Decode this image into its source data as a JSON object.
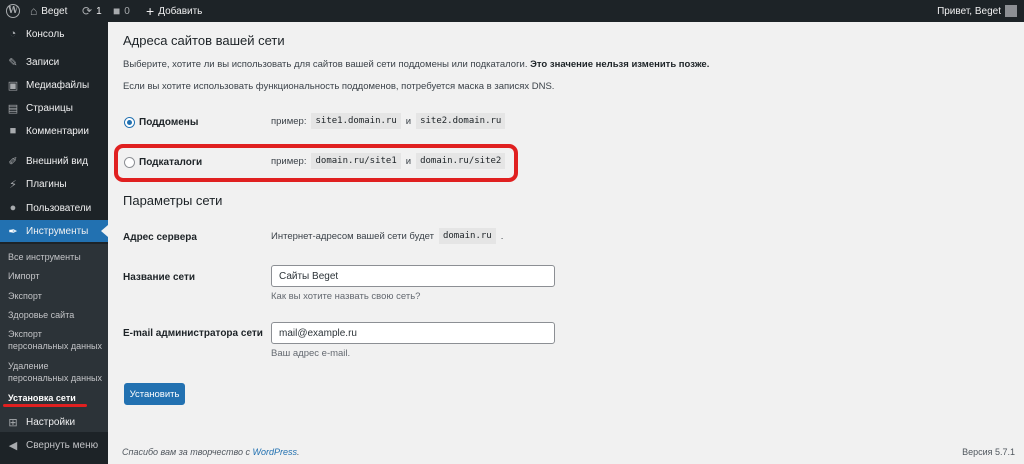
{
  "adminbar": {
    "site_name": "Beget",
    "updates_count": "1",
    "comments_count": "0",
    "add_new_label": "Добавить",
    "greeting": "Привет, Beget"
  },
  "sidebar": {
    "items": [
      {
        "label": "Консоль",
        "icon": "dashboard-icon"
      },
      {
        "label": "Записи",
        "icon": "pin-icon"
      },
      {
        "label": "Медиафайлы",
        "icon": "media-icon"
      },
      {
        "label": "Страницы",
        "icon": "pages-icon"
      },
      {
        "label": "Комментарии",
        "icon": "comment-icon"
      },
      {
        "label": "Внешний вид",
        "icon": "brush-icon"
      },
      {
        "label": "Плагины",
        "icon": "plug-icon"
      },
      {
        "label": "Пользователи",
        "icon": "users-icon"
      },
      {
        "label": "Инструменты",
        "icon": "wrench-icon"
      },
      {
        "label": "Настройки",
        "icon": "settings-icon"
      },
      {
        "label": "Свернуть меню",
        "icon": "collapse-icon"
      }
    ],
    "submenu": [
      "Все инструменты",
      "Импорт",
      "Экспорт",
      "Здоровье сайта",
      "Экспорт",
      "персональных данных",
      "Удаление",
      "персональных данных",
      "Установка сети"
    ]
  },
  "main": {
    "addresses_title": "Адреса сайтов вашей сети",
    "intro_text": "Выберите, хотите ли вы использовать для сайтов вашей сети поддомены или подкаталоги.",
    "intro_bold": "Это значение нельзя изменить позже.",
    "dns_note": "Если вы хотите использовать функциональность поддоменов, потребуется маска в записях DNS.",
    "subdomains_label": "Поддомены",
    "subdirs_label": "Подкаталоги",
    "example_prefix": "пример:",
    "and_word": "и",
    "subdomain_ex1": "site1.domain.ru",
    "subdomain_ex2": "site2.domain.ru",
    "subdir_ex1": "domain.ru/site1",
    "subdir_ex2": "domain.ru/site2",
    "params_title": "Параметры сети",
    "server_address_label": "Адрес сервера",
    "server_address_text": "Интернет-адресом вашей сети будет",
    "server_address_value": "domain.ru",
    "server_address_suffix": ".",
    "network_name_label": "Название сети",
    "network_name_value": "Сайты Beget",
    "network_name_desc": "Как вы хотите назвать свою сеть?",
    "admin_email_label": "E-mail администратора сети",
    "admin_email_value": "mail@example.ru",
    "admin_email_desc": "Ваш адрес e-mail.",
    "install_button": "Установить"
  },
  "footer": {
    "thanks_text": "Спасибо вам за творчество с",
    "wp_link": "WordPress",
    "period": ".",
    "version": "Версия 5.7.1"
  },
  "colors": {
    "accent": "#2271b1",
    "highlight": "#e02020",
    "sidebar_bg": "#1d2327"
  }
}
